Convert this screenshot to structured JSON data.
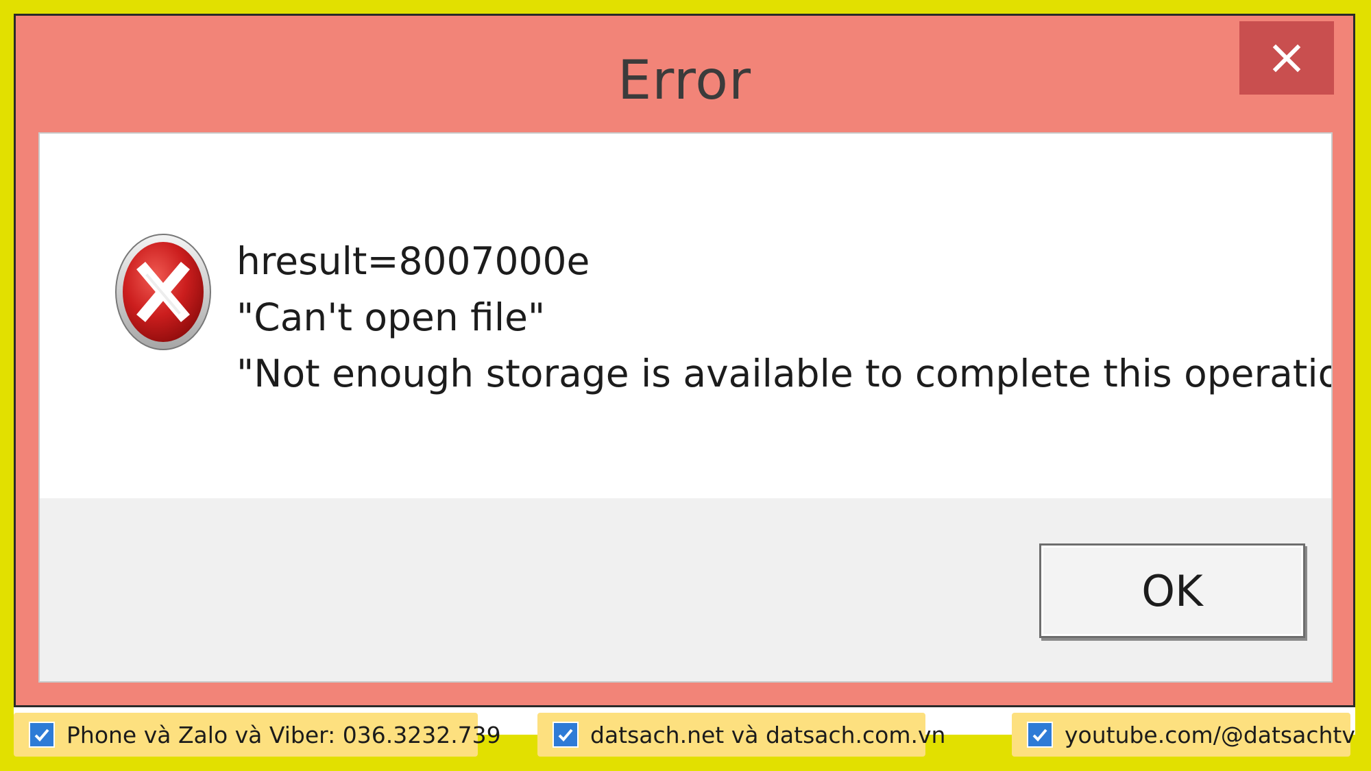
{
  "dialog": {
    "title": "Error",
    "close_icon": "close-icon",
    "error_icon": "error-circle-x-icon",
    "message_lines": [
      "hresult=8007000e",
      "\"Can't open file\"",
      "\"Not enough storage is available to complete this operation.\""
    ],
    "ok_label": "OK"
  },
  "colors": {
    "background_yellow": "#e2e000",
    "title_bar": "#f28478",
    "close_button": "#c94f4f",
    "badge_fill": "#fde07f",
    "check_blue": "#2e7bd6"
  },
  "badges": [
    {
      "text": "Phone và Zalo và Viber: 036.3232.739",
      "icon": "checkbox-icon"
    },
    {
      "text": "datsach.net và datsach.com.vn",
      "icon": "checkbox-icon"
    },
    {
      "text": "youtube.com/@datsachtv",
      "icon": "checkbox-icon"
    }
  ]
}
